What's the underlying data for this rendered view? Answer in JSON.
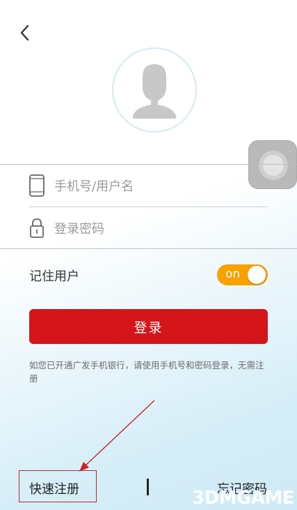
{
  "header": {
    "back_icon": "chevron-left-icon"
  },
  "avatar": {
    "icon": "default-user-avatar-icon"
  },
  "assistive_touch": {
    "icon": "assistive-touch-icon"
  },
  "form": {
    "username_placeholder": "手机号/用户名",
    "password_placeholder": "登录密码",
    "phone_icon": "phone-icon",
    "lock_icon": "lock-icon"
  },
  "remember": {
    "label": "记住用户",
    "toggle_text": "on",
    "toggle_on": true,
    "toggle_color": "#f7a200"
  },
  "login_button": {
    "label": "登录",
    "color": "#d4151a"
  },
  "notice": "如您已开通广发手机银行，请使用手机号和密码登录，无需注册",
  "footer": {
    "register_label": "快速注册",
    "forgot_label": "忘记密码",
    "highlight_color": "#c0262b"
  },
  "watermark": {
    "text": "3DMGAME"
  }
}
